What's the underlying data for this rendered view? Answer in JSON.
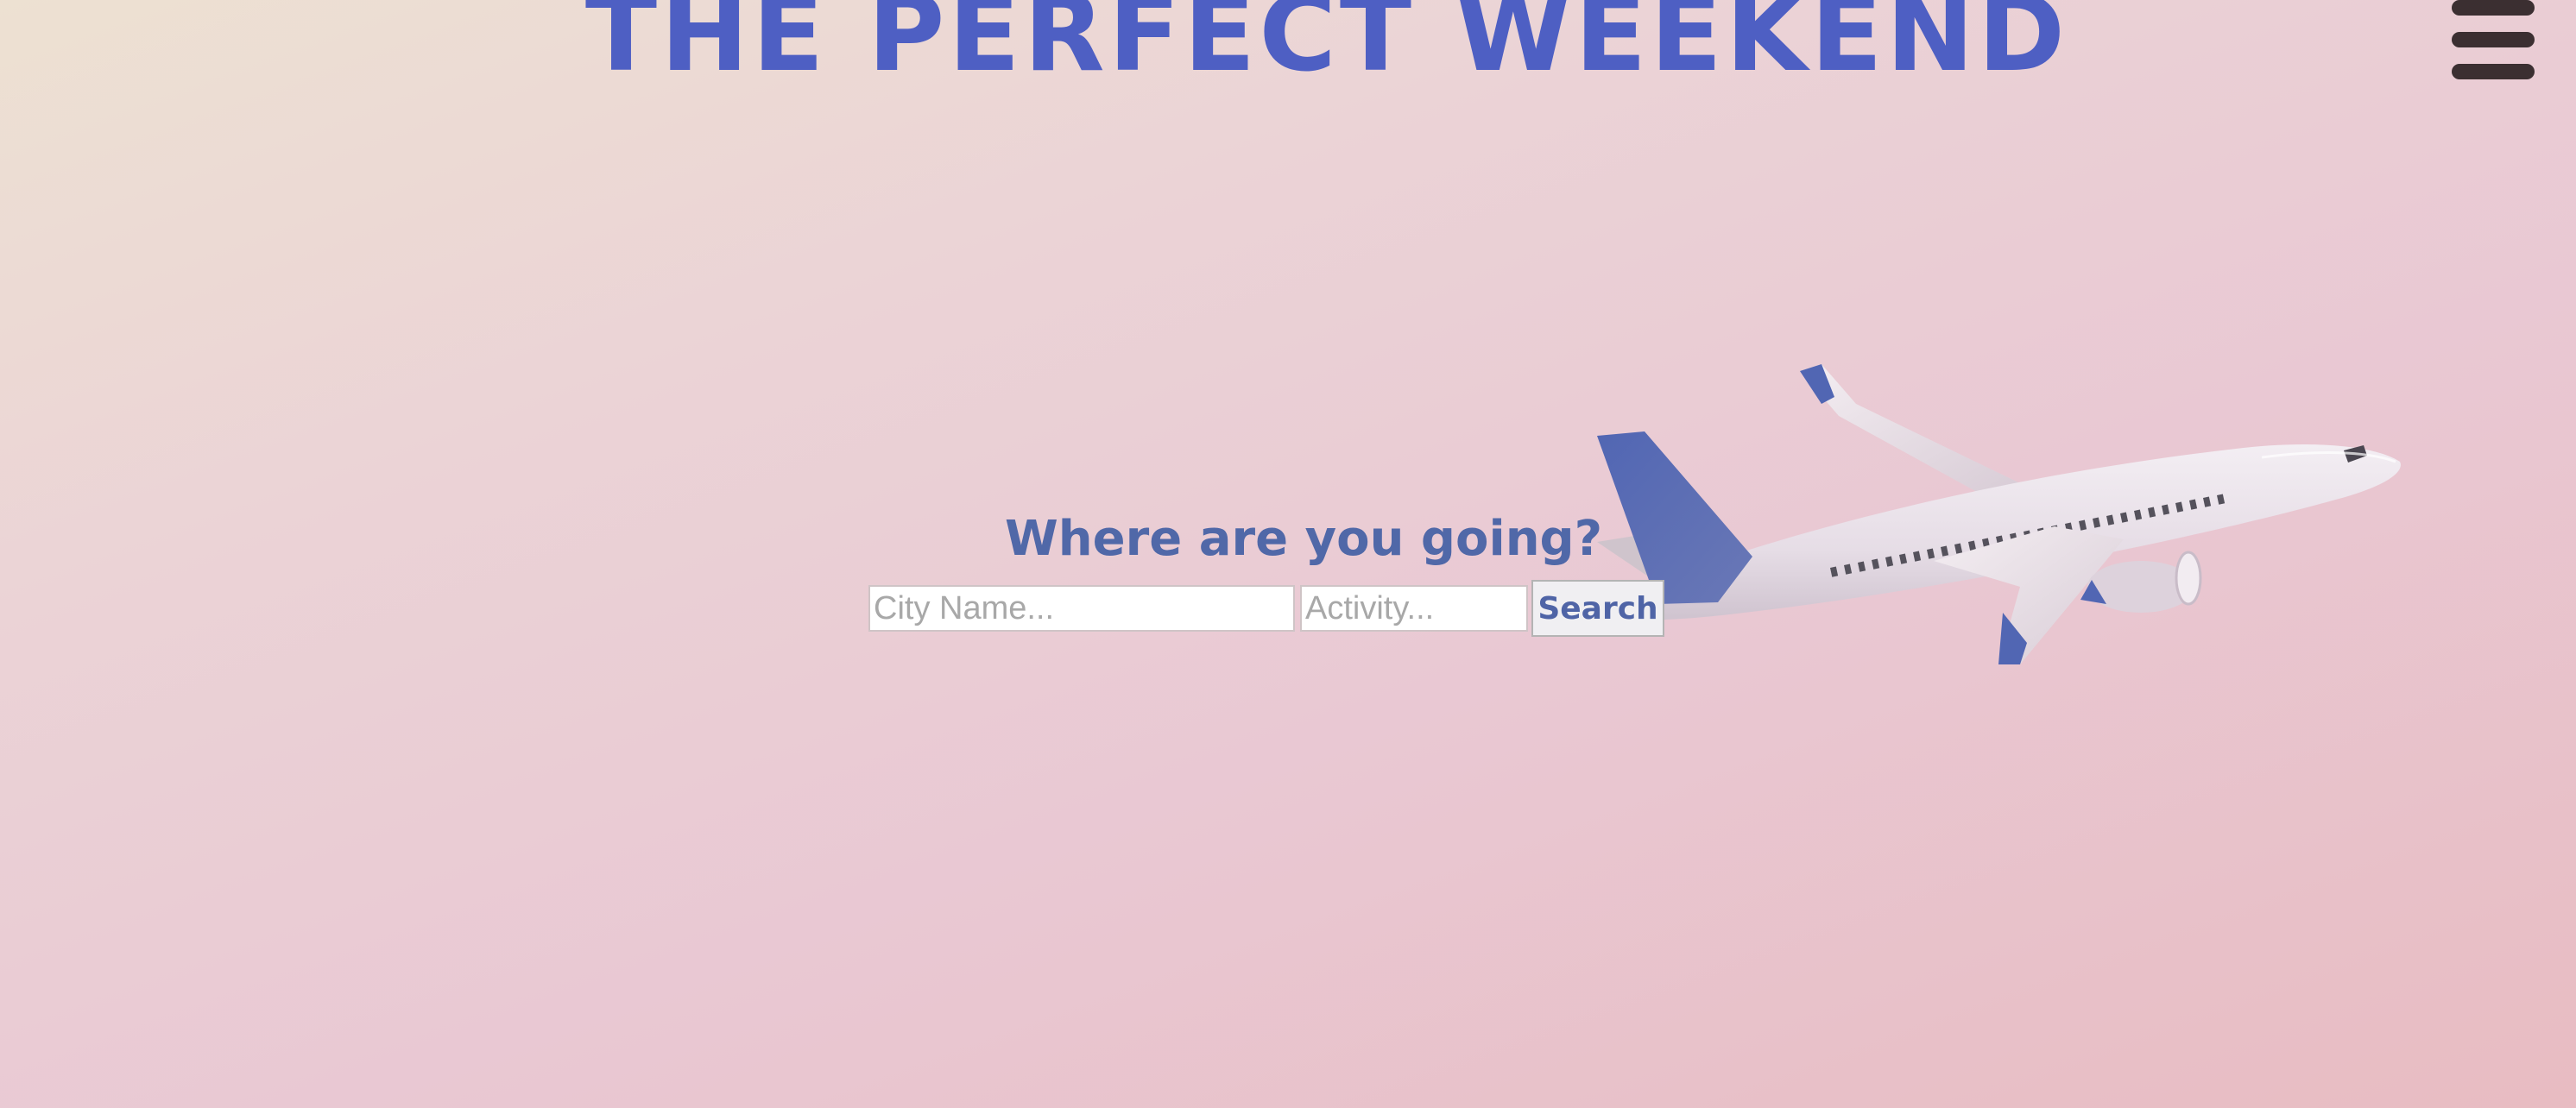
{
  "header": {
    "title": "THE PERFECT WEEKEND",
    "menu_icon": "hamburger-menu-icon"
  },
  "hero": {
    "illustration": "airplane-illustration"
  },
  "search": {
    "heading": "Where are you going?",
    "city_placeholder": "City Name...",
    "city_value": "",
    "activity_placeholder": "Activity...",
    "activity_value": "",
    "button_label": "Search"
  },
  "colors": {
    "title": "#4e5fc3",
    "heading": "#5068a8",
    "plane_accent": "#5a6fb8",
    "menu_icon": "#3b2f31"
  }
}
